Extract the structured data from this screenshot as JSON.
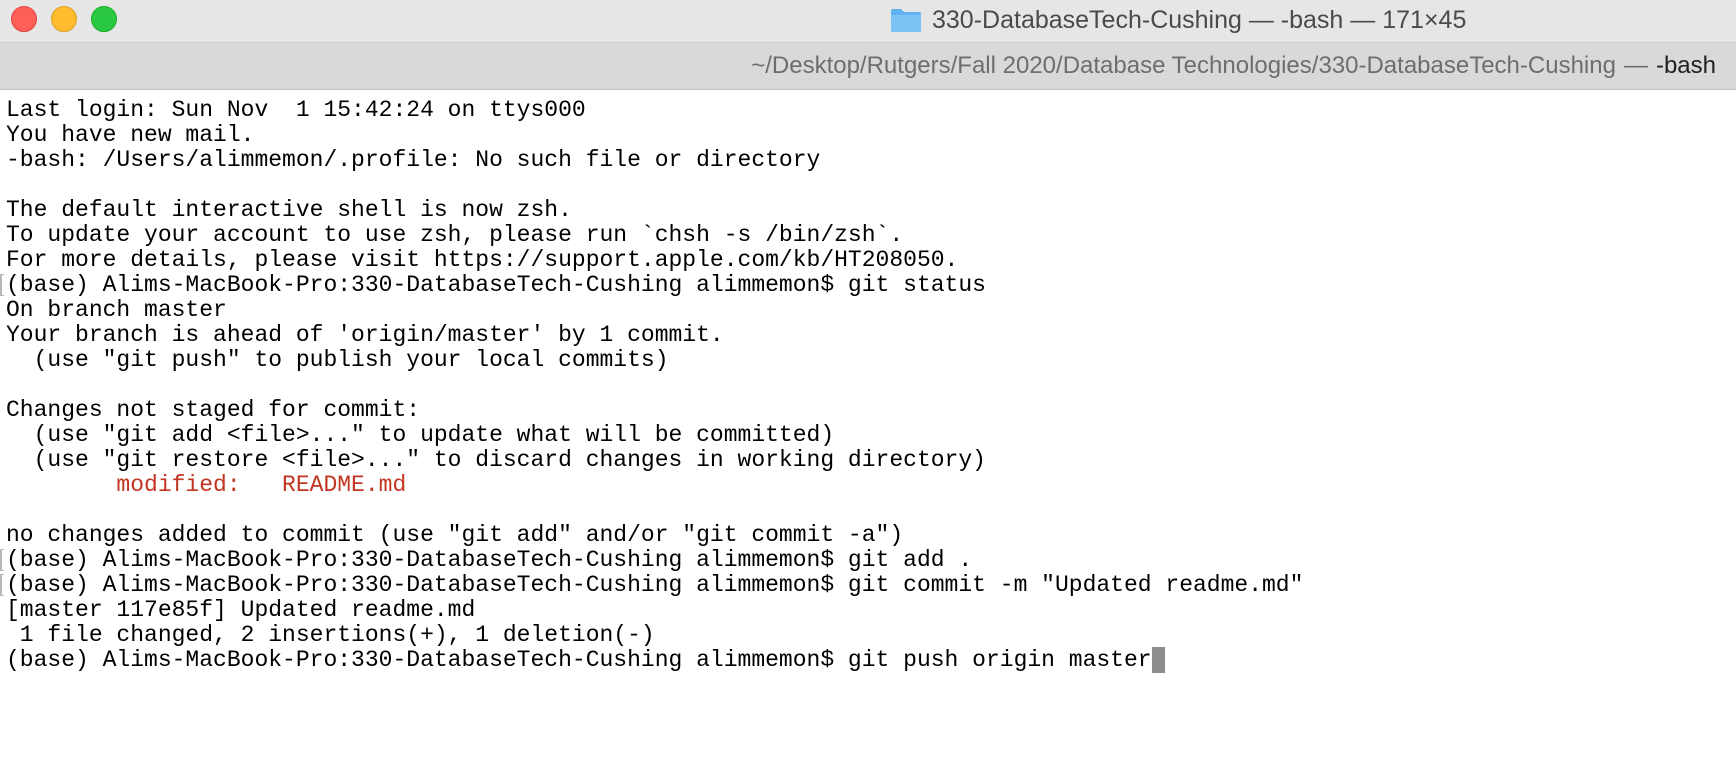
{
  "window": {
    "title": "330-DatabaseTech-Cushing — -bash — 171×45",
    "folder_icon": "folder-icon",
    "folder_color": "#5fb2ef"
  },
  "tab": {
    "path": "~/Desktop/Rutgers/Fall 2020/Database Technologies/330-DatabaseTech-Cushing",
    "separator": "—",
    "process": "-bash"
  },
  "terminal": {
    "lines": [
      "Last login: Sun Nov  1 15:42:24 on ttys000",
      "You have new mail.",
      "-bash: /Users/alimmemon/.profile: No such file or directory",
      "",
      "The default interactive shell is now zsh.",
      "To update your account to use zsh, please run `chsh -s /bin/zsh`.",
      "For more details, please visit https://support.apple.com/kb/HT208050.",
      "(base) Alims-MacBook-Pro:330-DatabaseTech-Cushing alimmemon$ git status",
      "On branch master",
      "Your branch is ahead of 'origin/master' by 1 commit.",
      "  (use \"git push\" to publish your local commits)",
      "",
      "Changes not staged for commit:",
      "  (use \"git add <file>...\" to update what will be committed)",
      "  (use \"git restore <file>...\" to discard changes in working directory)",
      "        modified:   README.md",
      "",
      "no changes added to commit (use \"git add\" and/or \"git commit -a\")",
      "(base) Alims-MacBook-Pro:330-DatabaseTech-Cushing alimmemon$ git add .",
      "(base) Alims-MacBook-Pro:330-DatabaseTech-Cushing alimmemon$ git commit -m \"Updated readme.md\"",
      "[master 117e85f] Updated readme.md",
      " 1 file changed, 2 insertions(+), 1 deletion(-)",
      "(base) Alims-MacBook-Pro:330-DatabaseTech-Cushing alimmemon$ git push origin master"
    ],
    "modified_color": "#c23621",
    "text_color": "#000000",
    "cursor_color": "#8c8c8c"
  },
  "colors": {
    "close": "#fe5f57",
    "minimize": "#febc2e",
    "zoom": "#28c840",
    "titlebar": "#e6e6e6",
    "tabbar": "#d9d9d9"
  }
}
